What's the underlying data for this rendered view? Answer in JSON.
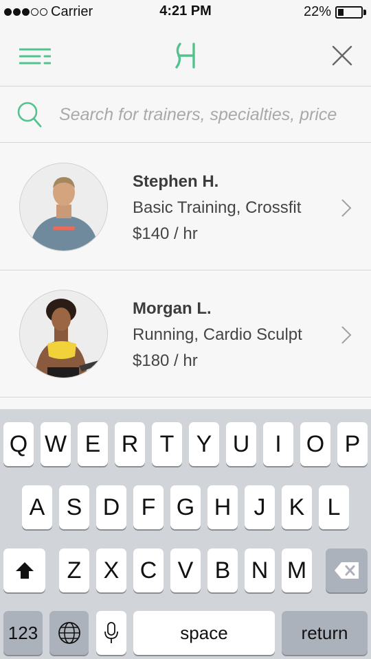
{
  "status_bar": {
    "carrier": "Carrier",
    "time": "4:21 PM",
    "battery_percent": "22%",
    "battery_level": 0.22,
    "signal_bars_filled": 3,
    "signal_bars_total": 5
  },
  "nav": {
    "menu_icon": "menu-icon",
    "logo_icon": "logo-icon",
    "close_icon": "close-icon",
    "accent_color": "#52c28f"
  },
  "search": {
    "placeholder": "Search for trainers, specialties, price",
    "value": ""
  },
  "trainers": [
    {
      "name": "Stephen H.",
      "specialties": "Basic Training, Crossfit",
      "price": "$140 / hr"
    },
    {
      "name": "Morgan L.",
      "specialties": "Running, Cardio Sculpt",
      "price": "$180 / hr"
    }
  ],
  "keyboard": {
    "row1": [
      "Q",
      "W",
      "E",
      "R",
      "T",
      "Y",
      "U",
      "I",
      "O",
      "P"
    ],
    "row2": [
      "A",
      "S",
      "D",
      "F",
      "G",
      "H",
      "J",
      "K",
      "L"
    ],
    "row3": [
      "Z",
      "X",
      "C",
      "V",
      "B",
      "N",
      "M"
    ],
    "numbers_label": "123",
    "space_label": "space",
    "return_label": "return"
  }
}
